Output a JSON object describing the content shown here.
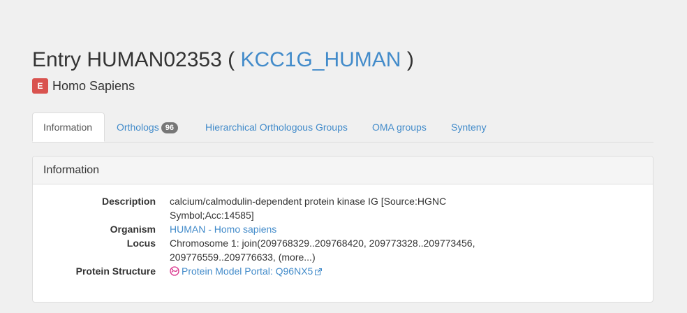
{
  "header": {
    "title_prefix": "Entry HUMAN02353 ( ",
    "title_link": "KCC1G_HUMAN",
    "title_suffix": " )"
  },
  "species": {
    "badge": "E",
    "name": "Homo Sapiens",
    "badge_color": "#d9534f"
  },
  "tabs": [
    {
      "label": "Information",
      "active": true
    },
    {
      "label": "Orthologs",
      "count": "96"
    },
    {
      "label": "Hierarchical Orthologous Groups"
    },
    {
      "label": "OMA groups"
    },
    {
      "label": "Synteny"
    }
  ],
  "panel": {
    "heading": "Information",
    "description_label": "Description",
    "description_line1": "calcium/calmodulin-dependent protein kinase IG [Source:HGNC",
    "description_line2": "Symbol;Acc:14585]",
    "organism_label": "Organism",
    "organism_value": "HUMAN - Homo sapiens",
    "locus_label": "Locus",
    "locus_line1": "Chromosome 1: join(209768329..209768420, 209773328..209773456,",
    "locus_line2_text": "209776559..209776633, ",
    "locus_more": "(more...)",
    "protein_structure_label": "Protein Structure",
    "protein_structure_value": "Protein Model Portal: Q96NX5"
  },
  "colors": {
    "link": "#428bca",
    "background": "#f0f0f0",
    "pill": "#777777"
  }
}
